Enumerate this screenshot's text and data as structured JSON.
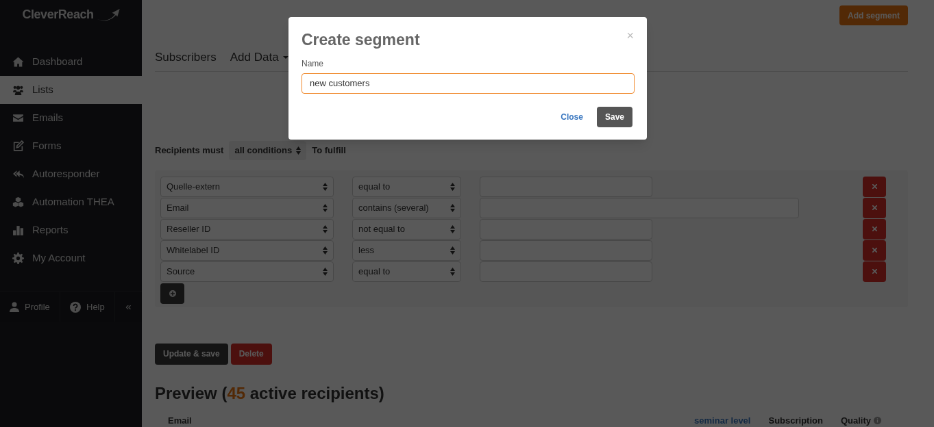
{
  "sidebar": {
    "logo": "CleverReach",
    "items": [
      {
        "label": "Dashboard",
        "selected": false
      },
      {
        "label": "Lists",
        "selected": true
      },
      {
        "label": "Emails",
        "selected": false
      },
      {
        "label": "Forms",
        "selected": false
      },
      {
        "label": "Autoresponder",
        "selected": false
      },
      {
        "label": "Automation THEA",
        "selected": false
      },
      {
        "label": "Reports",
        "selected": false
      },
      {
        "label": "My Account",
        "selected": false
      }
    ],
    "footer": {
      "profile": "Profile",
      "help": "Help",
      "collapse": "«"
    }
  },
  "header": {
    "add_button": "Add segment"
  },
  "tabs": [
    {
      "label": "Subscribers"
    },
    {
      "label": "Add Data",
      "dropdown": true
    }
  ],
  "filter": {
    "prefix": "Recipients must",
    "mode": "all conditions",
    "suffix": "To fulfill"
  },
  "conditions": [
    {
      "field": "Quelle-extern",
      "operator": "equal to",
      "kind": "single"
    },
    {
      "field": "Email",
      "operator": "contains (several)",
      "kind": "multiple"
    },
    {
      "field": "Reseller ID",
      "operator": "not equal to",
      "kind": "single"
    },
    {
      "field": "Whitelabel ID",
      "operator": "less",
      "kind": "single"
    },
    {
      "field": "Source",
      "operator": "equal to",
      "kind": "single"
    }
  ],
  "actions": {
    "update": "Update & save",
    "delete": "Delete"
  },
  "preview": {
    "title": "Preview (**45** active recipients)",
    "columns": [
      {
        "label": "Email",
        "kind": "plain"
      },
      {
        "label": "seminar level",
        "kind": "link"
      },
      {
        "label": "Subscription",
        "kind": "plain"
      },
      {
        "label": "Quality",
        "kind": "info"
      }
    ]
  },
  "modal": {
    "title": "Create segment",
    "close_icon": "×",
    "field_label": "Name",
    "value": "new customers",
    "close": "Close",
    "save": "Save"
  }
}
